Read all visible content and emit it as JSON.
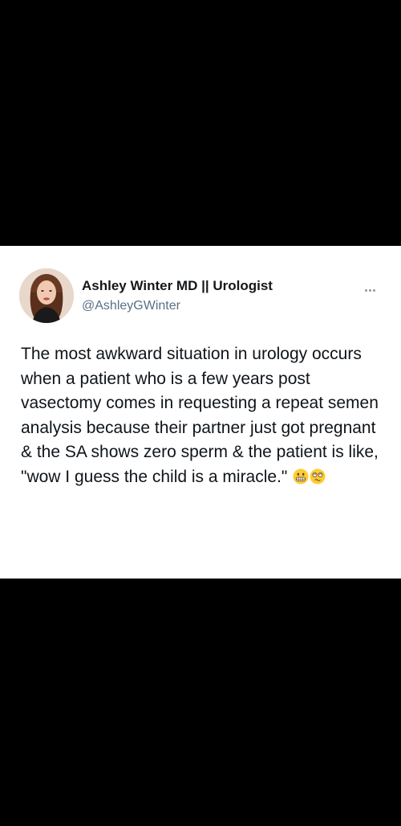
{
  "tweet": {
    "author_name": "Ashley Winter MD || Urologist",
    "author_handle": "@AshleyGWinter",
    "text": "The most awkward situation in urology occurs when a patient who is a few years post vasectomy comes in requesting a repeat semen analysis because their partner just got pregnant & the SA shows zero sperm & the patient is like, \"wow I guess the child is a miracle.\"",
    "emojis": [
      "grimacing-face-emoji",
      "dizzy-face-emoji"
    ],
    "more_icon": "more-options-icon"
  },
  "colors": {
    "card_background": "#ffffff",
    "page_background": "#000000",
    "name_color": "#14171a",
    "handle_color": "#5b7083",
    "text_color": "#0f1419"
  }
}
